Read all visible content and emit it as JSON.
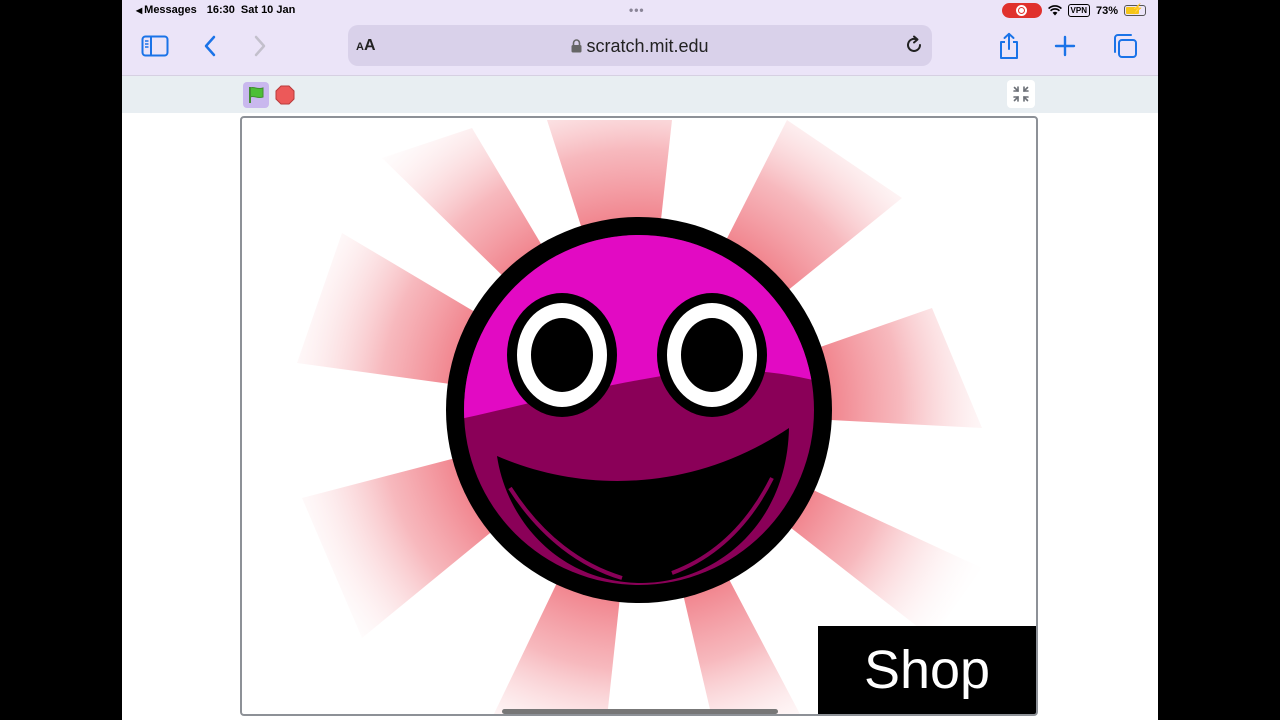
{
  "status_bar": {
    "back_app": "Messages",
    "time": "16:30",
    "date": "Sat 10 Jan",
    "dots": "•••",
    "vpn": "VPN",
    "battery": "73%",
    "battery_level": 0.73
  },
  "browser": {
    "text_size_label": "AA",
    "url": "scratch.mit.edu",
    "accent_color": "#1a73e8"
  },
  "scratch_player": {
    "stage": {
      "sprite": "smiley-face",
      "shop_label": "Shop"
    }
  }
}
